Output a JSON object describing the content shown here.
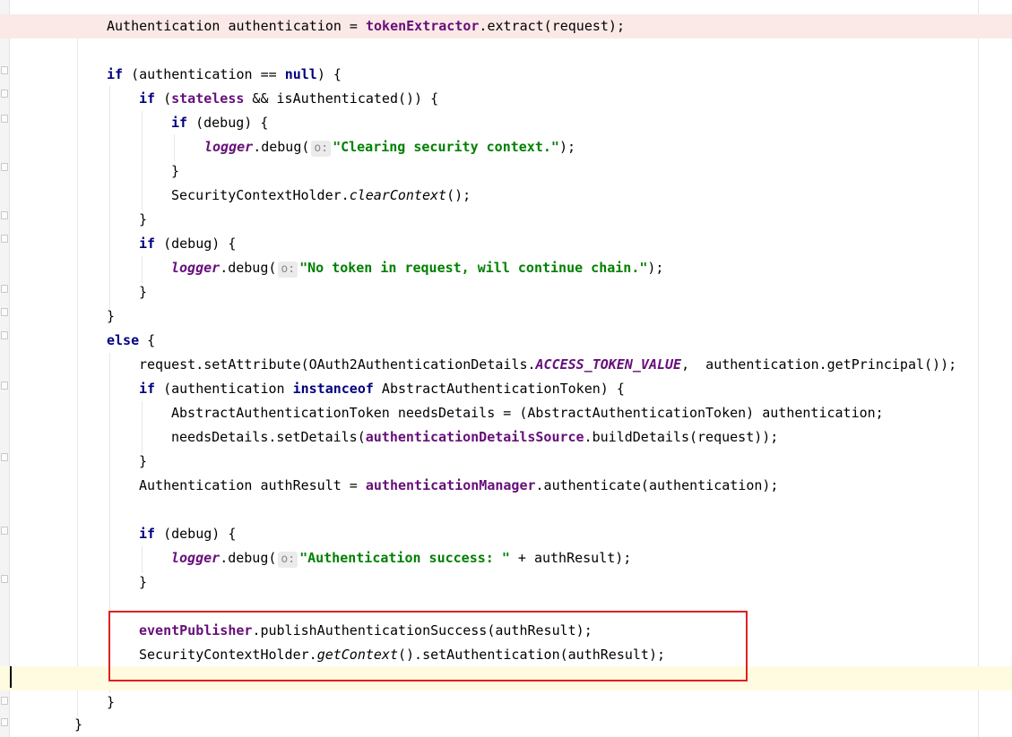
{
  "lines": [
    {
      "n": "line-1",
      "code": [
        {
          "t": "Authentication authentication = ",
          "c": ""
        },
        {
          "t": "tokenExtractor",
          "c": "field"
        },
        {
          "t": ".extract(request);",
          "c": ""
        }
      ]
    },
    {
      "n": "line-3",
      "code": [
        {
          "t": "if",
          "c": "kw"
        },
        {
          "t": " (authentication == ",
          "c": ""
        },
        {
          "t": "null",
          "c": "kw"
        },
        {
          "t": ") {",
          "c": ""
        }
      ]
    },
    {
      "n": "line-4",
      "code": [
        {
          "t": "if",
          "c": "kw"
        },
        {
          "t": " (",
          "c": ""
        },
        {
          "t": "stateless",
          "c": "field"
        },
        {
          "t": " && isAuthenticated()) {",
          "c": ""
        }
      ]
    },
    {
      "n": "line-5",
      "code": [
        {
          "t": "if",
          "c": "kw"
        },
        {
          "t": " (debug) {",
          "c": ""
        }
      ]
    },
    {
      "n": "line-6",
      "code": [
        {
          "t": "logger",
          "c": "field-i"
        },
        {
          "t": ".debug(",
          "c": ""
        },
        {
          "t": "o:",
          "c": "hint"
        },
        {
          "t": "\"Clearing security context.\"",
          "c": "str"
        },
        {
          "t": ");",
          "c": ""
        }
      ]
    },
    {
      "n": "line-7",
      "code": [
        {
          "t": "}",
          "c": ""
        }
      ]
    },
    {
      "n": "line-8",
      "code": [
        {
          "t": "SecurityContextHolder.",
          "c": ""
        },
        {
          "t": "clearContext",
          "c": "static-i"
        },
        {
          "t": "();",
          "c": ""
        }
      ]
    },
    {
      "n": "line-9",
      "code": [
        {
          "t": "}",
          "c": ""
        }
      ]
    },
    {
      "n": "line-10",
      "code": [
        {
          "t": "if",
          "c": "kw"
        },
        {
          "t": " (debug) {",
          "c": ""
        }
      ]
    },
    {
      "n": "line-11",
      "code": [
        {
          "t": "logger",
          "c": "field-i"
        },
        {
          "t": ".debug(",
          "c": ""
        },
        {
          "t": "o:",
          "c": "hint"
        },
        {
          "t": "\"No token in request, will continue chain.\"",
          "c": "str"
        },
        {
          "t": ");",
          "c": ""
        }
      ]
    },
    {
      "n": "line-12",
      "code": [
        {
          "t": "}",
          "c": ""
        }
      ]
    },
    {
      "n": "line-13",
      "code": [
        {
          "t": "}",
          "c": ""
        }
      ]
    },
    {
      "n": "line-14",
      "code": [
        {
          "t": "else",
          "c": "kw"
        },
        {
          "t": " {",
          "c": ""
        }
      ]
    },
    {
      "n": "line-15",
      "code": [
        {
          "t": "request.setAttribute(OAuth2AuthenticationDetails.",
          "c": ""
        },
        {
          "t": "ACCESS_TOKEN_VALUE",
          "c": "field-i"
        },
        {
          "t": ",  authentication.getPrincipal());",
          "c": ""
        }
      ]
    },
    {
      "n": "line-16",
      "code": [
        {
          "t": "if",
          "c": "kw"
        },
        {
          "t": " (authentication ",
          "c": ""
        },
        {
          "t": "instanceof",
          "c": "kw"
        },
        {
          "t": " AbstractAuthenticationToken) {",
          "c": ""
        }
      ]
    },
    {
      "n": "line-17",
      "code": [
        {
          "t": "AbstractAuthenticationToken needsDetails = (AbstractAuthenticationToken) authentication;",
          "c": ""
        }
      ]
    },
    {
      "n": "line-18",
      "code": [
        {
          "t": "needsDetails.setDetails(",
          "c": ""
        },
        {
          "t": "authenticationDetailsSource",
          "c": "field"
        },
        {
          "t": ".buildDetails(request));",
          "c": ""
        }
      ]
    },
    {
      "n": "line-19",
      "code": [
        {
          "t": "}",
          "c": ""
        }
      ]
    },
    {
      "n": "line-20",
      "code": [
        {
          "t": "Authentication authResult = ",
          "c": ""
        },
        {
          "t": "authenticationManager",
          "c": "field"
        },
        {
          "t": ".authenticate(authentication);",
          "c": ""
        }
      ]
    },
    {
      "n": "line-22",
      "code": [
        {
          "t": "if",
          "c": "kw"
        },
        {
          "t": " (debug) {",
          "c": ""
        }
      ]
    },
    {
      "n": "line-23",
      "code": [
        {
          "t": "logger",
          "c": "field-i"
        },
        {
          "t": ".debug(",
          "c": ""
        },
        {
          "t": "o:",
          "c": "hint"
        },
        {
          "t": "\"Authentication success: \"",
          "c": "str"
        },
        {
          "t": " + authResult);",
          "c": ""
        }
      ]
    },
    {
      "n": "line-24",
      "code": [
        {
          "t": "}",
          "c": ""
        }
      ]
    },
    {
      "n": "line-26",
      "code": [
        {
          "t": "eventPublisher",
          "c": "field"
        },
        {
          "t": ".publishAuthenticationSuccess(authResult);",
          "c": ""
        }
      ]
    },
    {
      "n": "line-27",
      "code": [
        {
          "t": "SecurityContextHolder.",
          "c": ""
        },
        {
          "t": "getContext",
          "c": "static-i"
        },
        {
          "t": "().setAuthentication(authResult);",
          "c": ""
        }
      ]
    },
    {
      "n": "line-29",
      "code": [
        {
          "t": "}",
          "c": ""
        }
      ]
    },
    {
      "n": "line-30",
      "code": [
        {
          "t": "}",
          "c": ""
        }
      ]
    }
  ]
}
